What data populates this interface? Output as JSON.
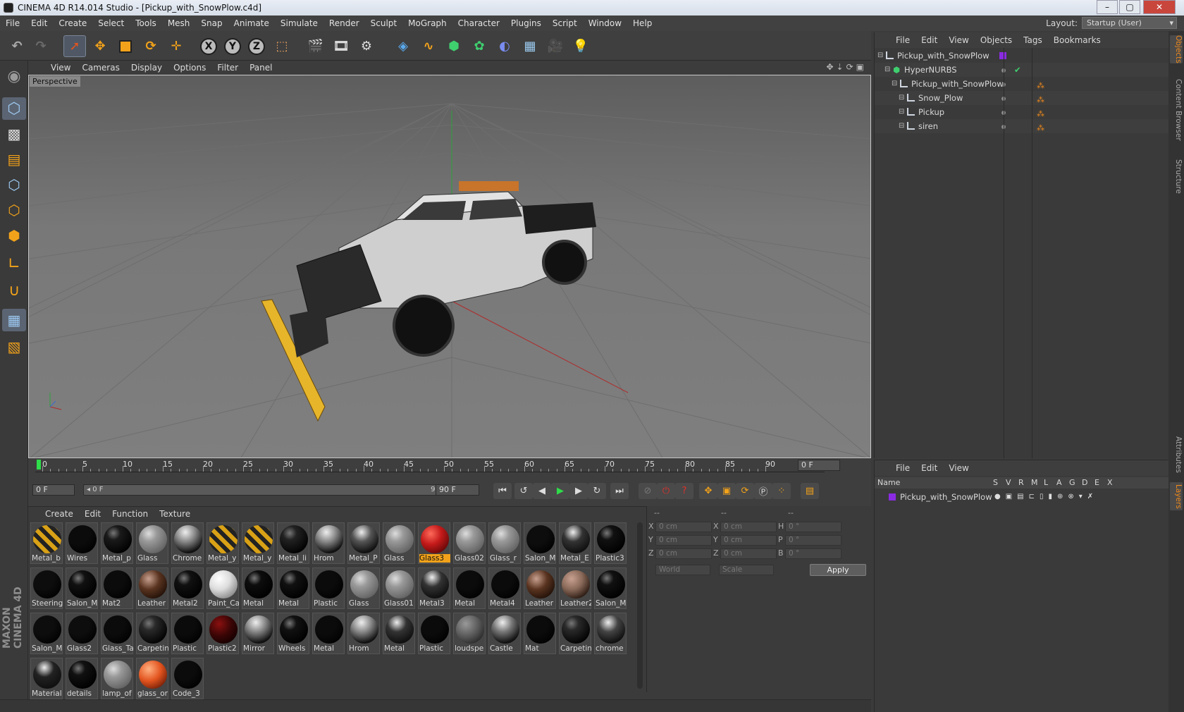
{
  "window": {
    "title": "CINEMA 4D R14.014 Studio - [Pickup_with_SnowPlow.c4d]",
    "min": "–",
    "max": "▢",
    "close": "✕"
  },
  "menubar": {
    "items": [
      "File",
      "Edit",
      "Create",
      "Select",
      "Tools",
      "Mesh",
      "Snap",
      "Animate",
      "Simulate",
      "Render",
      "Sculpt",
      "MoGraph",
      "Character",
      "Plugins",
      "Script",
      "Window",
      "Help"
    ]
  },
  "layout": {
    "label": "Layout:",
    "value": "Startup (User)"
  },
  "toolbar": {
    "axes": [
      "X",
      "Y",
      "Z"
    ]
  },
  "viewport": {
    "menu": [
      "View",
      "Cameras",
      "Display",
      "Options",
      "Filter",
      "Panel"
    ],
    "label": "Perspective",
    "nav_icons": "✥⇣⟳▣"
  },
  "timeline": {
    "ticks": [
      "0",
      "5",
      "10",
      "15",
      "20",
      "25",
      "30",
      "35",
      "40",
      "45",
      "50",
      "55",
      "60",
      "65",
      "70",
      "75",
      "80",
      "85",
      "90"
    ],
    "current_frame_right": "0 F",
    "start_field": "0 F",
    "slider_left": "◂ 0 F",
    "slider_right": "90 F ▸",
    "end_field": "90 F"
  },
  "materials": {
    "menu": [
      "Create",
      "Edit",
      "Function",
      "Texture"
    ],
    "items": [
      {
        "name": "Metal_b",
        "color": "#d9a116",
        "style": "stripe"
      },
      {
        "name": "Wires",
        "color": "#0b0b0b",
        "style": "dark"
      },
      {
        "name": "Metal_p",
        "color": "#1a1a1a",
        "style": "gloss"
      },
      {
        "name": "Glass",
        "color": "#707070",
        "style": "glass"
      },
      {
        "name": "Chrome",
        "color": "#8a8a8a",
        "style": "chrome"
      },
      {
        "name": "Metal_y",
        "color": "#d9a116",
        "style": "stripe"
      },
      {
        "name": "Metal_y",
        "color": "#d9a116",
        "style": "stripe"
      },
      {
        "name": "Metal_li",
        "color": "#222",
        "style": "gloss"
      },
      {
        "name": "Hrom",
        "color": "#8a8a8a",
        "style": "chrome"
      },
      {
        "name": "Metal_P",
        "color": "#555",
        "style": "chrome"
      },
      {
        "name": "Glass",
        "color": "#707070",
        "style": "glass"
      },
      {
        "name": "Glass3",
        "color": "#c41a1a",
        "style": "red",
        "selected": true
      },
      {
        "name": "Glass02",
        "color": "#8a8a8a",
        "style": "glass"
      },
      {
        "name": "Glass_r",
        "color": "#8a8a8a",
        "style": "glass"
      },
      {
        "name": "Salon_M",
        "color": "#0d0d0d",
        "style": "dark"
      },
      {
        "name": "Metal_E",
        "color": "#333",
        "style": "chrome"
      },
      {
        "name": "Plastic3",
        "color": "#111",
        "style": "gloss"
      },
      {
        "name": "Steering",
        "color": "#0d0d0d",
        "style": "dark"
      },
      {
        "name": "Salon_M",
        "color": "#111",
        "style": "gloss"
      },
      {
        "name": "Mat2",
        "color": "#0b0b0b",
        "style": "dark"
      },
      {
        "name": "Leather",
        "color": "#5a3420",
        "style": "brown"
      },
      {
        "name": "Metal2",
        "color": "#111",
        "style": "gloss"
      },
      {
        "name": "Paint_Ca",
        "color": "#e0e0e0",
        "style": "white"
      },
      {
        "name": "Metal",
        "color": "#0d0d0d",
        "style": "gloss"
      },
      {
        "name": "Metal",
        "color": "#111",
        "style": "gloss"
      },
      {
        "name": "Plastic",
        "color": "#0b0b0b",
        "style": "dark"
      },
      {
        "name": "Glass",
        "color": "#707070",
        "style": "glass"
      },
      {
        "name": "Glass01",
        "color": "#7a6a6a",
        "style": "glass"
      },
      {
        "name": "Metal3",
        "color": "#333",
        "style": "chrome"
      },
      {
        "name": "Metal",
        "color": "#0b0b0b",
        "style": "dark"
      },
      {
        "name": "Metal4",
        "color": "#0b0b0b",
        "style": "dark"
      },
      {
        "name": "Leather",
        "color": "#5a3420",
        "style": "brown"
      },
      {
        "name": "Leather2",
        "color": "#8a6a5a",
        "style": "brown"
      },
      {
        "name": "Salon_M",
        "color": "#111",
        "style": "gloss"
      },
      {
        "name": "Salon_M",
        "color": "#0d0d0d",
        "style": "dark"
      },
      {
        "name": "Glass2",
        "color": "#0d0d0d",
        "style": "dark"
      },
      {
        "name": "Glass_Ta",
        "color": "#0b0b0b",
        "style": "dark"
      },
      {
        "name": "Carpetin",
        "color": "#2a2a2a",
        "style": "gloss"
      },
      {
        "name": "Plastic",
        "color": "#0b0b0b",
        "style": "dark"
      },
      {
        "name": "Plastic2",
        "color": "#3a0505",
        "style": "darkred"
      },
      {
        "name": "Mirror",
        "color": "#888",
        "style": "chrome"
      },
      {
        "name": "Wheels",
        "color": "#111",
        "style": "gloss"
      },
      {
        "name": "Metal",
        "color": "#0b0b0b",
        "style": "dark"
      },
      {
        "name": "Hrom",
        "color": "#8a8a8a",
        "style": "chrome"
      },
      {
        "name": "Metal",
        "color": "#333",
        "style": "chrome"
      },
      {
        "name": "Plastic",
        "color": "#0b0b0b",
        "style": "dark"
      },
      {
        "name": "loudspe",
        "color": "#5a5a5a",
        "style": "noise"
      },
      {
        "name": "Castle",
        "color": "#777",
        "style": "chrome"
      },
      {
        "name": "Mat",
        "color": "#0b0b0b",
        "style": "dark"
      },
      {
        "name": "Carpetin",
        "color": "#2a2a2a",
        "style": "gloss"
      },
      {
        "name": "chrome",
        "color": "#444",
        "style": "chrome"
      },
      {
        "name": "Material",
        "color": "#222",
        "style": "chrome"
      },
      {
        "name": "details",
        "color": "#111",
        "style": "gloss"
      },
      {
        "name": "lamp_of",
        "color": "#707070",
        "style": "glass"
      },
      {
        "name": "glass_or",
        "color": "#e2541f",
        "style": "orange"
      },
      {
        "name": "Code_3",
        "color": "#0b0b0b",
        "style": "dark"
      }
    ]
  },
  "attributes": {
    "col_heads": [
      "--",
      "--",
      "--"
    ],
    "rows": [
      {
        "a": "X",
        "v1": "0 cm",
        "b": "X",
        "v2": "0 cm",
        "c": "H",
        "v3": "0 °"
      },
      {
        "a": "Y",
        "v1": "0 cm",
        "b": "Y",
        "v2": "0 cm",
        "c": "P",
        "v3": "0 °"
      },
      {
        "a": "Z",
        "v1": "0 cm",
        "b": "Z",
        "v2": "0 cm",
        "c": "B",
        "v3": "0 °"
      }
    ],
    "world": "World",
    "scale": "Scale",
    "apply": "Apply"
  },
  "objects": {
    "menu": [
      "File",
      "Edit",
      "View",
      "Objects",
      "Tags",
      "Bookmarks"
    ],
    "tree": [
      {
        "label": "Pickup_with_SnowPlow",
        "depth": 0,
        "icon": "null"
      },
      {
        "label": "HyperNURBS",
        "depth": 1,
        "icon": "nurbs"
      },
      {
        "label": "Pickup_with_SnowPlow",
        "depth": 2,
        "icon": "null"
      },
      {
        "label": "Snow_Plow",
        "depth": 3,
        "icon": "null"
      },
      {
        "label": "Pickup",
        "depth": 3,
        "icon": "null"
      },
      {
        "label": "siren",
        "depth": 3,
        "icon": "null"
      }
    ]
  },
  "layers": {
    "menu": [
      "File",
      "Edit",
      "View"
    ],
    "header": {
      "name": "Name",
      "cols": [
        "S",
        "V",
        "R",
        "M",
        "L",
        "A",
        "G",
        "D",
        "E",
        "X"
      ]
    },
    "row": "Pickup_with_SnowPlow"
  },
  "right_tabs": [
    "Objects",
    "Content Browser",
    "Structure",
    "Attributes",
    "Layers"
  ]
}
